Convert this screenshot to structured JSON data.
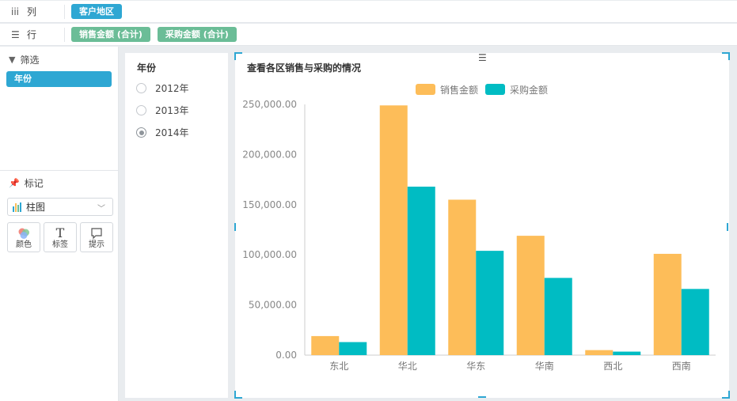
{
  "shelves": {
    "columns": {
      "label": "列",
      "pills": [
        "客户地区"
      ]
    },
    "rows": {
      "label": "行",
      "pills": [
        "销售金额 (合计)",
        "采购金额 (合计)"
      ]
    }
  },
  "filter_panel": {
    "title": "筛选",
    "pill": "年份"
  },
  "marks_panel": {
    "title": "标记",
    "type_select": "柱图",
    "buttons": [
      "颜色",
      "标签",
      "提示"
    ]
  },
  "year_filter": {
    "title": "年份",
    "options": [
      "2012年",
      "2013年",
      "2014年"
    ],
    "selected_index": 2
  },
  "colors": {
    "sales": "#fdbd59",
    "purchase": "#00bcc3",
    "accent": "#2ea7d3",
    "pill_green": "#6bbd97"
  },
  "chart_data": {
    "type": "bar",
    "title": "查看各区销售与采购的情况",
    "categories": [
      "东北",
      "华北",
      "华东",
      "华南",
      "西北",
      "西南"
    ],
    "series": [
      {
        "name": "销售金额",
        "values": [
          19000,
          249000,
          155000,
          119000,
          5000,
          101000
        ]
      },
      {
        "name": "采购金额",
        "values": [
          13000,
          168000,
          104000,
          77000,
          3500,
          66000
        ]
      }
    ],
    "y_ticks": [
      "0.00",
      "50,000.00",
      "100,000.00",
      "150,000.00",
      "200,000.00",
      "250,000.00"
    ],
    "ylim": [
      0,
      250000
    ],
    "legend": "top-center",
    "grid": false
  }
}
